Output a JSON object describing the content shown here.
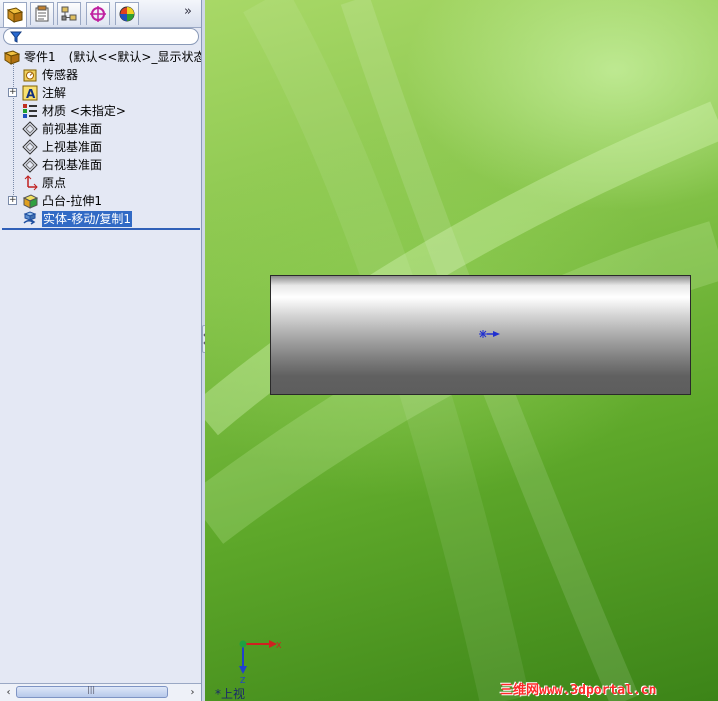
{
  "tabs": [
    {
      "name": "featuremanager-tab",
      "icon": "featuremanager-icon"
    },
    {
      "name": "propertymanager-tab",
      "icon": "propertymanager-icon"
    },
    {
      "name": "configurationmanager-tab",
      "icon": "configurationmanager-icon"
    },
    {
      "name": "dimxpert-tab",
      "icon": "dimxpert-icon"
    },
    {
      "name": "display-manager-tab",
      "icon": "display-manager-icon"
    }
  ],
  "tab_more_label": "»",
  "tree": {
    "root_label": "零件1",
    "root_config": "(默认<<默认>_显示状态",
    "items": [
      {
        "label": "传感器"
      },
      {
        "label": "注解"
      },
      {
        "label": "材质 <未指定>"
      },
      {
        "label": "前视基准面"
      },
      {
        "label": "上视基准面"
      },
      {
        "label": "右视基准面"
      },
      {
        "label": "原点"
      },
      {
        "label": "凸台-拉伸1"
      },
      {
        "label": "实体-移动/复制1"
      }
    ]
  },
  "scrollbar": {
    "left_arrow": "‹",
    "right_arrow": "›",
    "grip": "|||"
  },
  "viewport": {
    "triad_x": "X",
    "triad_z": "Z",
    "view_label": "*上视",
    "watermark": "三维网www.3dportal.cn"
  },
  "colors": {
    "selection": "#316ac5",
    "rollback": "#3060b8",
    "watermark": "#ff2a2a"
  }
}
